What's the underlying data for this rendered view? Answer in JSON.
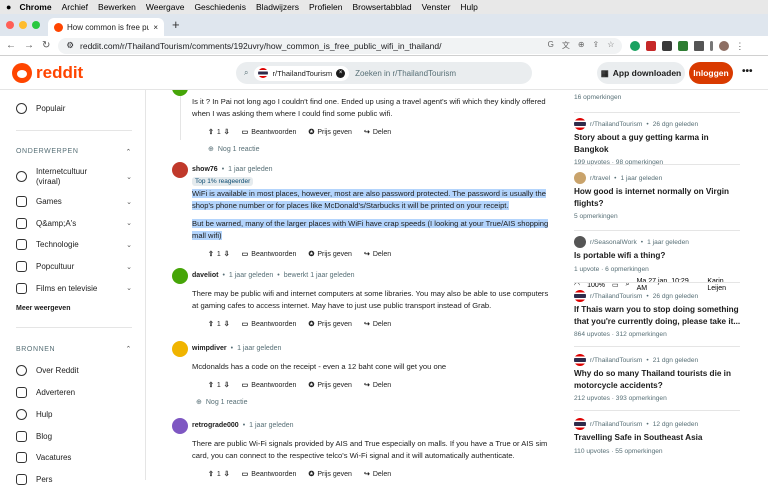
{
  "mac": {
    "menu": [
      "Chrome",
      "Archief",
      "Bewerken",
      "Weergave",
      "Geschiedenis",
      "Bladwijzers",
      "Profielen",
      "Browsertabblad",
      "Venster",
      "Hulp"
    ],
    "battery": "100%",
    "clock": "Ma 27 jan.  10:29 AM",
    "user": "Karin Leijen"
  },
  "browser": {
    "tab_title": "How common is free public wifi",
    "url": "reddit.com/r/ThailandTourism/comments/192uvry/how_common_is_free_public_wifi_in_thailand/"
  },
  "header": {
    "logo": "reddit",
    "search_chip": "r/ThailandTourism",
    "search_placeholder": "Zoeken in r/ThailandTourism",
    "app_button": "App downloaden",
    "login_button": "Inloggen",
    "more": "•••"
  },
  "sidebar": {
    "popular": "Populair",
    "topics_header": "ONDERWERPEN",
    "topics": [
      "Internetcultuur (viraal)",
      "Games",
      "Q&amp;A's",
      "Technologie",
      "Popcultuur",
      "Films en televisie"
    ],
    "more": "Meer weergeven",
    "resources_header": "BRONNEN",
    "resources": [
      "Over Reddit",
      "Adverteren",
      "Hulp",
      "Blog",
      "Vacatures",
      "Pers"
    ]
  },
  "labels": {
    "reply": "Beantwoorden",
    "award": "Prijs geven",
    "share": "Delen",
    "more_replies": "Nog 1 reactie"
  },
  "comments": [
    {
      "text": [
        "Is it ? In Pai not long ago I couldn't find one. Ended up using a travel agent's wifi which they kindly offered when I was asking them where I could find some public wifi."
      ],
      "votes": "1"
    },
    {
      "user": "show76",
      "time": "1 jaar geleden",
      "badge": "Top 1% reageerder",
      "text": [
        "WiFi is available in most places, however, most are also password protected. The password is usually the shop's phone number or for places like McDonald's/Starbucks it will be printed on your receipt.",
        "But be warned, many of the larger places with WiFi have crap speeds (I looking at your True/AIS shopping mall wifi)"
      ],
      "votes": "1"
    },
    {
      "user": "daveliot",
      "time": "1 jaar geleden",
      "edited": "bewerkt 1 jaar geleden",
      "text": [
        "There may be public wifi and internet computers at some libraries. You may also be able to use computers at gaming cafes to access internet. May have to just use public transport instead of Grab."
      ],
      "votes": "1"
    },
    {
      "user": "wimpdiver",
      "time": "1 jaar geleden",
      "text": [
        "Mcdonalds has a code on the receipt - even a 12 baht cone will get you one"
      ],
      "votes": "1"
    },
    {
      "user": "retrograde000",
      "time": "1 jaar geleden",
      "text": [
        "There are public Wi-Fi signals provided by AIS and True especially on malls. If you have a True or AIS sim card, you can connect to the respective telco's Wi-Fi signal and it will automatically authenticate."
      ],
      "votes": "1"
    }
  ],
  "related": [
    {
      "meta": "16 opmerkingen"
    },
    {
      "sub": "r/ThailandTourism",
      "time": "26 dgn geleden",
      "title": "Story about a guy getting karma in Bangkok",
      "meta": "199 upvotes  ·  98 opmerkingen"
    },
    {
      "sub": "r/travel",
      "time": "1 jaar geleden",
      "title": "How good is internet normally on Virgin flights?",
      "meta": "5 opmerkingen"
    },
    {
      "sub": "r/SeasonalWork",
      "time": "1 jaar geleden",
      "title": "Is portable wifi a thing?",
      "meta": "1 upvote  ·  6 opmerkingen"
    },
    {
      "sub": "r/ThailandTourism",
      "time": "26 dgn geleden",
      "title": "If Thais warn you to stop doing something that you're currently doing, please take it...",
      "meta": "864 upvotes  ·  312 opmerkingen"
    },
    {
      "sub": "r/ThailandTourism",
      "time": "21 dgn geleden",
      "title": "Why do so many Thailand tourists die in motorcycle accidents?",
      "meta": "212 upvotes  ·  393 opmerkingen"
    },
    {
      "sub": "r/ThailandTourism",
      "time": "12 dgn geleden",
      "title": "Travelling Safe in Southeast Asia",
      "meta": "110 upvotes  ·  55 opmerkingen"
    }
  ],
  "colors": {
    "reddit_orange": "#ff4500",
    "login": "#d93a00",
    "highlight": "#b3d4fc"
  }
}
